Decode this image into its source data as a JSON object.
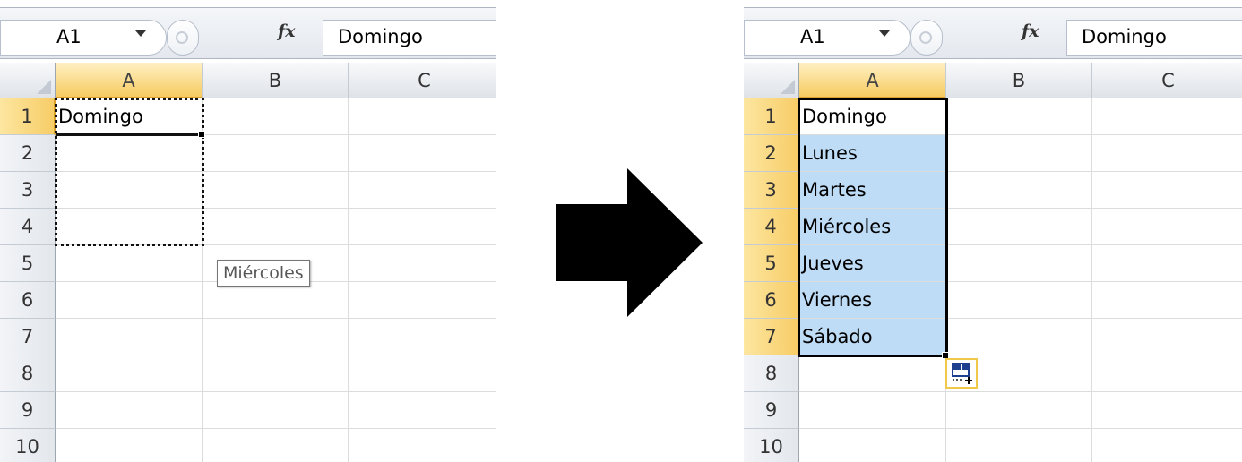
{
  "left": {
    "name_box": "A1",
    "formula_fx": "fx",
    "formula_value": "Domingo",
    "columns": [
      "A",
      "B",
      "C"
    ],
    "rows": [
      "1",
      "2",
      "3",
      "4",
      "5",
      "6",
      "7",
      "8",
      "9",
      "10"
    ],
    "cells": {
      "A1": "Domingo"
    },
    "fill_tooltip": "Miércoles"
  },
  "right": {
    "name_box": "A1",
    "formula_fx": "fx",
    "formula_value": "Domingo",
    "columns": [
      "A",
      "B",
      "C"
    ],
    "rows": [
      "1",
      "2",
      "3",
      "4",
      "5",
      "6",
      "7",
      "8",
      "9",
      "10"
    ],
    "cells": {
      "A1": "Domingo",
      "A2": "Lunes",
      "A3": "Martes",
      "A4": "Miércoles",
      "A5": "Jueves",
      "A6": "Viernes",
      "A7": "Sábado"
    }
  },
  "icons": {
    "name_box_dropdown": "chevron-down-icon",
    "formula_insert_function": "fx-icon",
    "transition": "right-arrow-icon",
    "autofill_options": "autofill-options-icon"
  },
  "colors": {
    "selection_fill": "#bfdcf7",
    "header_selected": "#f6cb60",
    "grid_line": "#dadcdd"
  }
}
